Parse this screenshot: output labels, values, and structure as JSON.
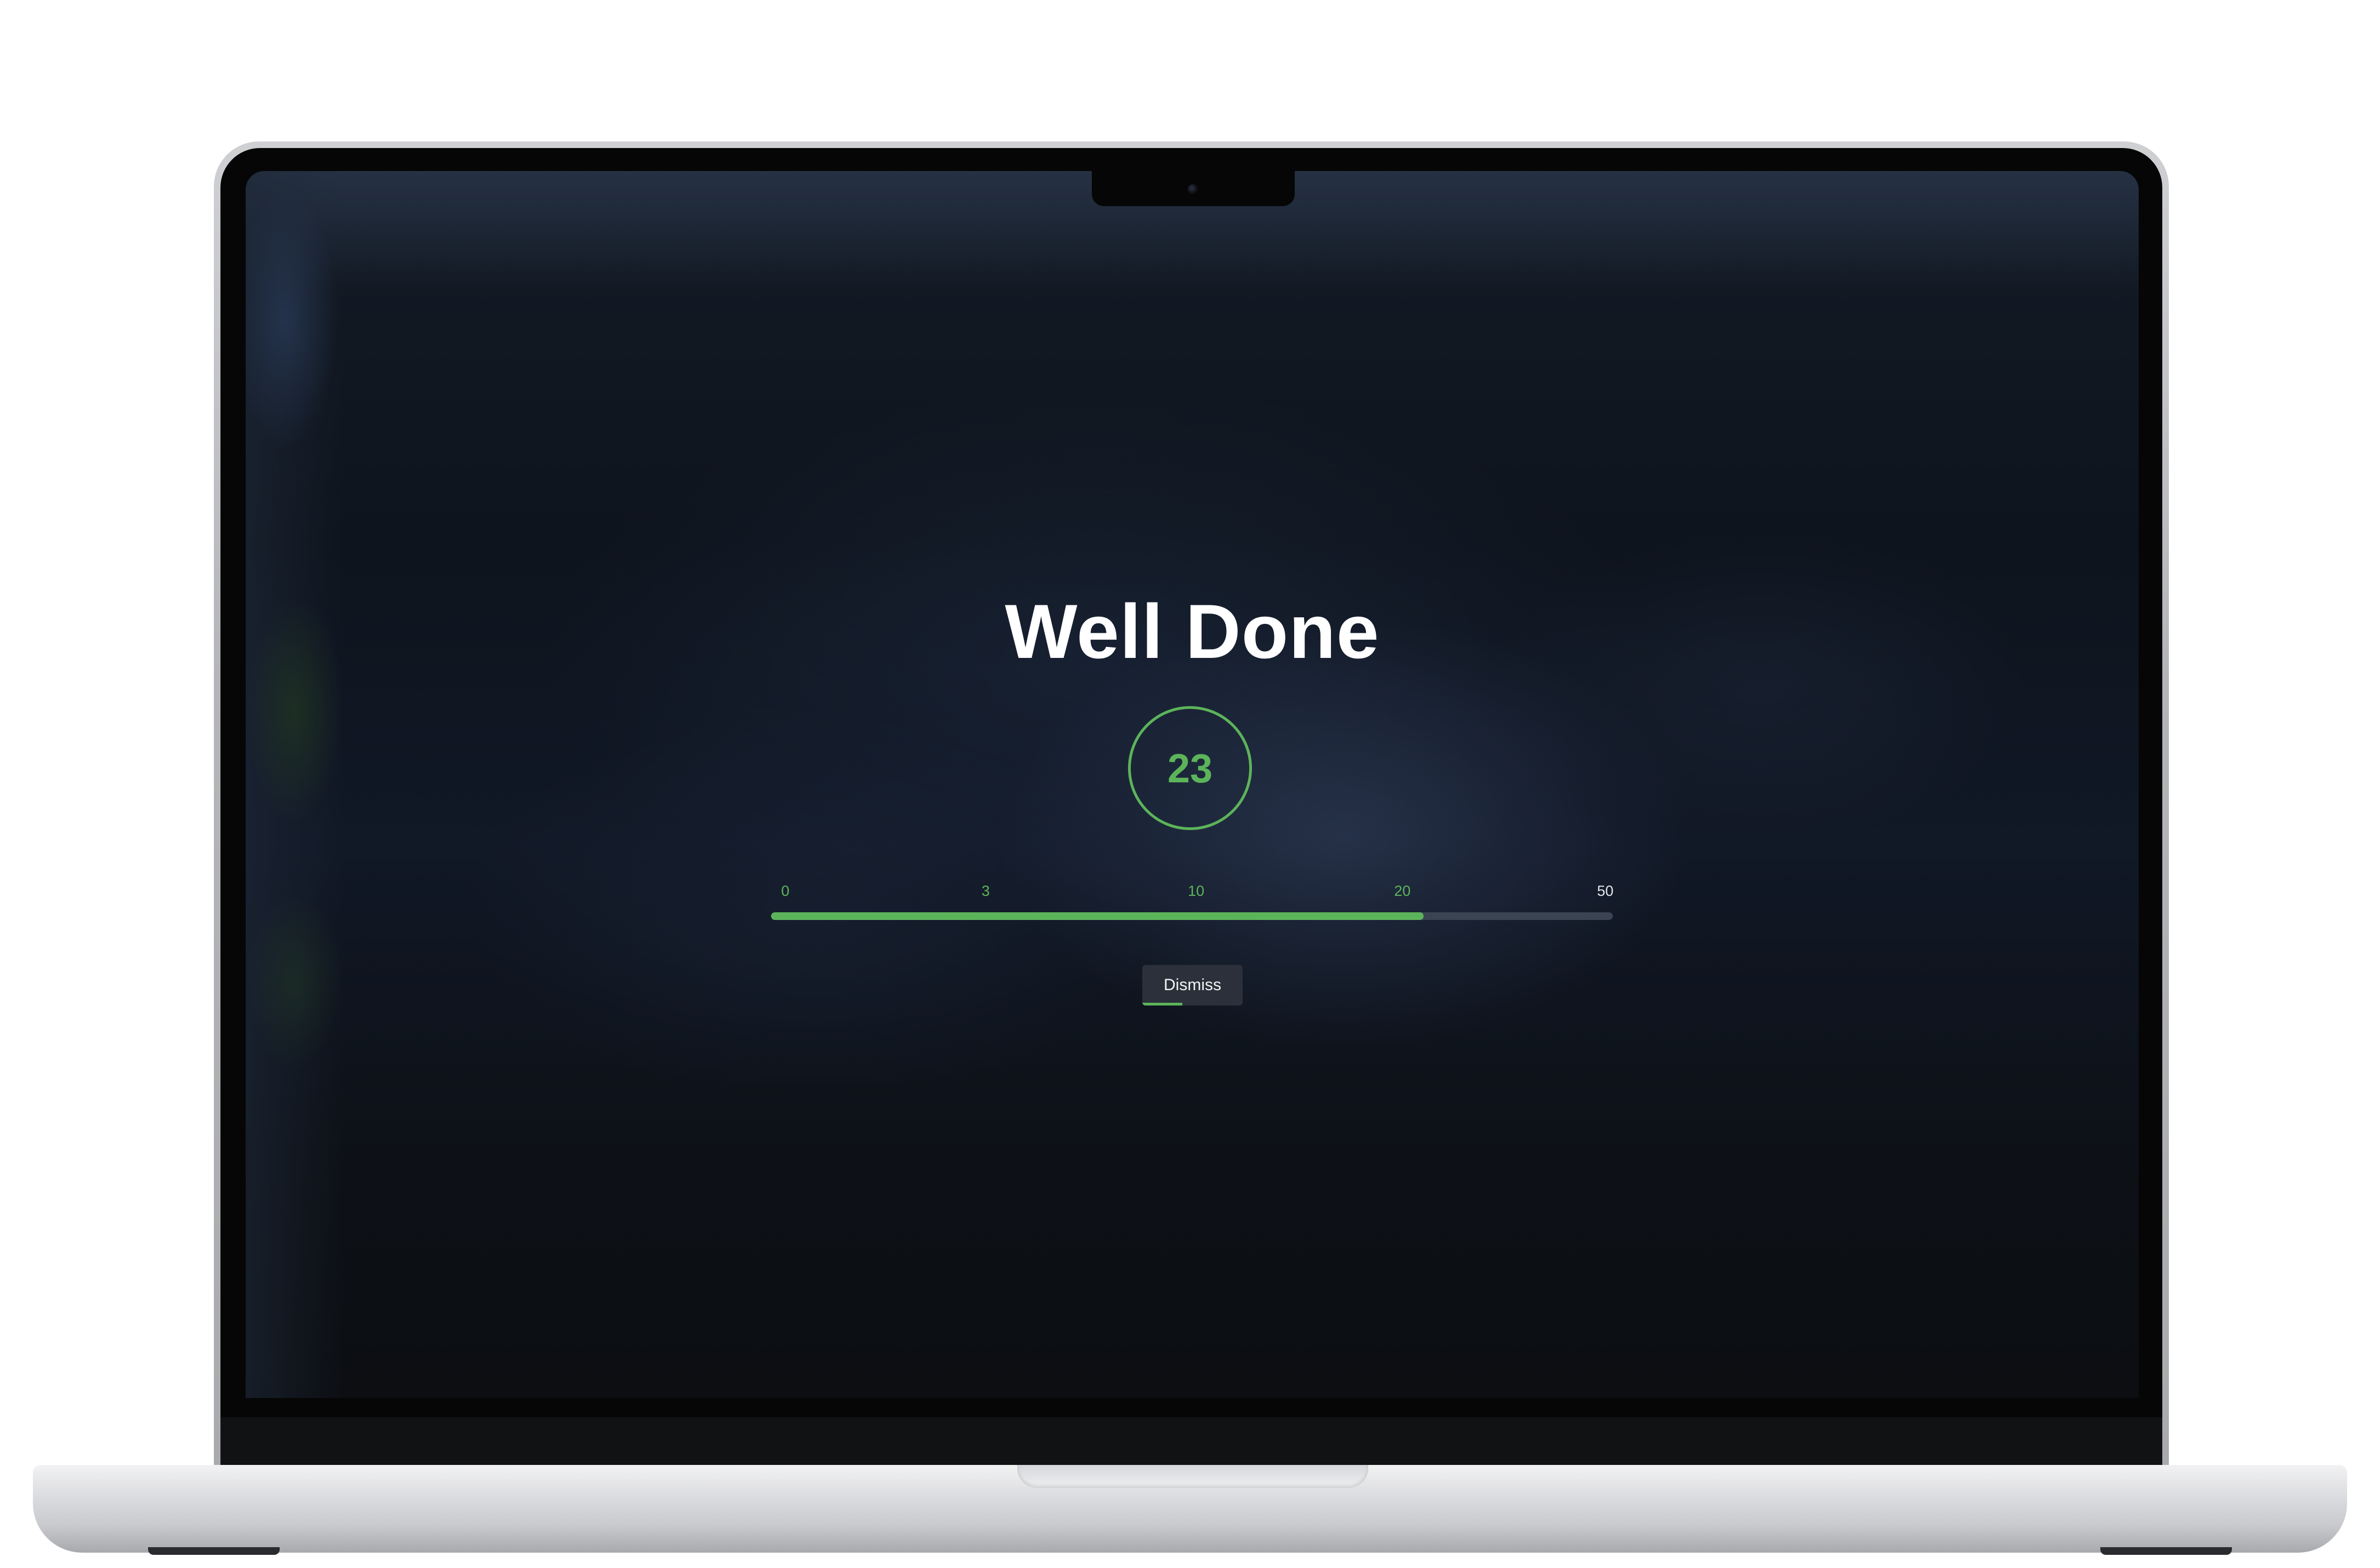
{
  "dialog": {
    "title": "Well Done",
    "score": "23",
    "milestones": [
      "0",
      "3",
      "10",
      "20",
      "50"
    ],
    "progress_value": 23,
    "progress_max": 50,
    "dismiss_label": "Dismiss",
    "dismiss_countdown_fraction": 0.4
  },
  "colors": {
    "accent": "#5cb45a",
    "track": "#3b4452",
    "title": "#ffffff",
    "button_bg": "#2b303a"
  }
}
